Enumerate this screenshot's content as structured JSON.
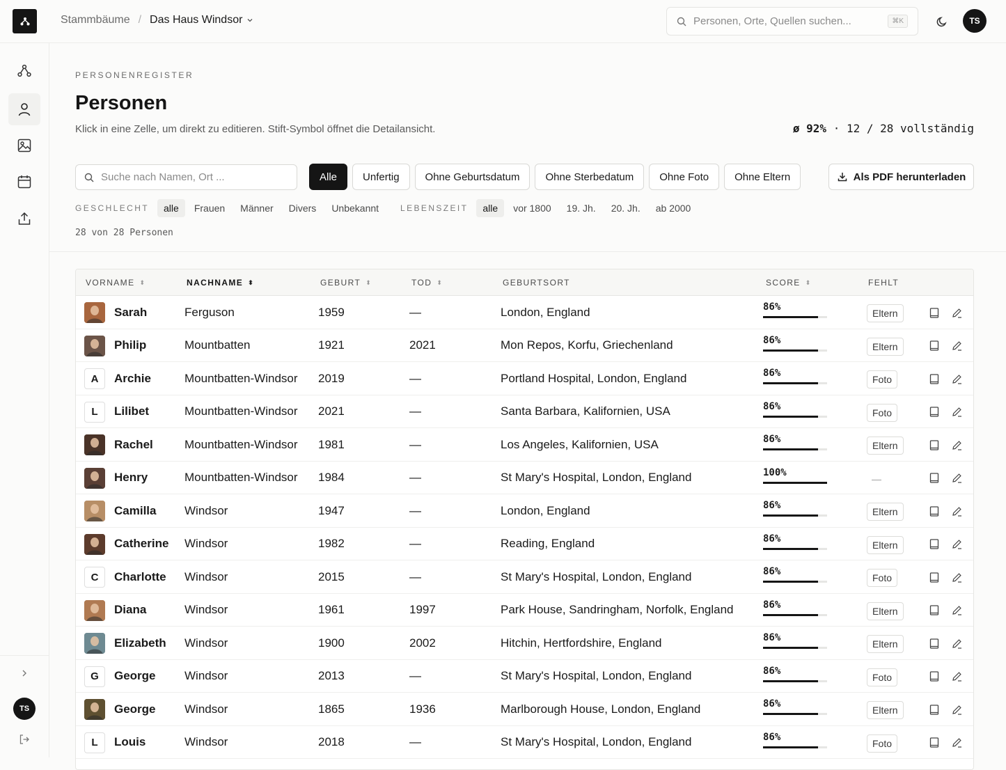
{
  "breadcrumb": {
    "root": "Stammbäume",
    "separator": "/",
    "current": "Das Haus Windsor"
  },
  "search": {
    "placeholder": "Personen, Orte, Quellen suchen...",
    "shortcut": "⌘K"
  },
  "user": {
    "initials": "TS"
  },
  "page": {
    "eyebrow": "PERSONENREGISTER",
    "title": "Personen",
    "subtitle": "Klick in eine Zelle, um direkt zu editieren. Stift-Symbol öffnet die Detailansicht.",
    "completeness_avg": "ø 92%",
    "completeness_rest": "· 12 / 28 vollständig"
  },
  "filter": {
    "placeholder": "Suche nach Namen, Ort ...",
    "chips": [
      "Alle",
      "Unfertig",
      "Ohne Geburtsdatum",
      "Ohne Sterbedatum",
      "Ohne Foto",
      "Ohne Eltern"
    ],
    "active_chip": "Alle",
    "pdf_label": "Als PDF herunterladen",
    "gender_label": "GESCHLECHT",
    "gender_options": [
      "alle",
      "Frauen",
      "Männer",
      "Divers",
      "Unbekannt"
    ],
    "lifetime_label": "LEBENSZEIT",
    "lifetime_options": [
      "alle",
      "vor 1800",
      "19. Jh.",
      "20. Jh.",
      "ab 2000"
    ],
    "count": "28 von 28 Personen"
  },
  "table": {
    "headers": [
      "VORNAME",
      "NACHNAME",
      "GEBURT",
      "TOD",
      "GEBURTSORT",
      "SCORE",
      "FEHLT"
    ],
    "rows": [
      {
        "first": "Sarah",
        "last": "Ferguson",
        "birth": "1959",
        "death": "—",
        "place": "London, England",
        "score": "86%",
        "score_value": 0.86,
        "missing": "Eltern",
        "photo": "#a8663e",
        "initial": ""
      },
      {
        "first": "Philip",
        "last": "Mountbatten",
        "birth": "1921",
        "death": "2021",
        "place": "Mon Repos, Korfu, Griechenland",
        "score": "86%",
        "score_value": 0.86,
        "missing": "Eltern",
        "photo": "#6b5448",
        "initial": ""
      },
      {
        "first": "Archie",
        "last": "Mountbatten-Windsor",
        "birth": "2019",
        "death": "—",
        "place": "Portland Hospital, London, England",
        "score": "86%",
        "score_value": 0.86,
        "missing": "Foto",
        "photo": "",
        "initial": "A"
      },
      {
        "first": "Lilibet",
        "last": "Mountbatten-Windsor",
        "birth": "2021",
        "death": "—",
        "place": "Santa Barbara, Kalifornien, USA",
        "score": "86%",
        "score_value": 0.86,
        "missing": "Foto",
        "photo": "",
        "initial": "L"
      },
      {
        "first": "Rachel",
        "last": "Mountbatten-Windsor",
        "birth": "1981",
        "death": "—",
        "place": "Los Angeles, Kalifornien, USA",
        "score": "86%",
        "score_value": 0.86,
        "missing": "Eltern",
        "photo": "#4a3328",
        "initial": ""
      },
      {
        "first": "Henry",
        "last": "Mountbatten-Windsor",
        "birth": "1984",
        "death": "—",
        "place": "St Mary's Hospital, London, England",
        "score": "100%",
        "score_value": 1.0,
        "missing": "—",
        "photo": "#5a3f35",
        "initial": ""
      },
      {
        "first": "Camilla",
        "last": "Windsor",
        "birth": "1947",
        "death": "—",
        "place": "London, England",
        "score": "86%",
        "score_value": 0.86,
        "missing": "Eltern",
        "photo": "#b78e66",
        "initial": ""
      },
      {
        "first": "Catherine",
        "last": "Windsor",
        "birth": "1982",
        "death": "—",
        "place": "Reading, England",
        "score": "86%",
        "score_value": 0.86,
        "missing": "Eltern",
        "photo": "#5c3b2c",
        "initial": ""
      },
      {
        "first": "Charlotte",
        "last": "Windsor",
        "birth": "2015",
        "death": "—",
        "place": "St Mary's Hospital, London, England",
        "score": "86%",
        "score_value": 0.86,
        "missing": "Foto",
        "photo": "",
        "initial": "C"
      },
      {
        "first": "Diana",
        "last": "Windsor",
        "birth": "1961",
        "death": "1997",
        "place": "Park House, Sandringham, Norfolk, England",
        "score": "86%",
        "score_value": 0.86,
        "missing": "Eltern",
        "photo": "#b07a52",
        "initial": ""
      },
      {
        "first": "Elizabeth",
        "last": "Windsor",
        "birth": "1900",
        "death": "2002",
        "place": "Hitchin, Hertfordshire, England",
        "score": "86%",
        "score_value": 0.86,
        "missing": "Eltern",
        "photo": "#6e8a92",
        "initial": ""
      },
      {
        "first": "George",
        "last": "Windsor",
        "birth": "2013",
        "death": "—",
        "place": "St Mary's Hospital, London, England",
        "score": "86%",
        "score_value": 0.86,
        "missing": "Foto",
        "photo": "",
        "initial": "G"
      },
      {
        "first": "George",
        "last": "Windsor",
        "birth": "1865",
        "death": "1936",
        "place": "Marlborough House, London, England",
        "score": "86%",
        "score_value": 0.86,
        "missing": "Eltern",
        "photo": "#5e5031",
        "initial": ""
      },
      {
        "first": "Louis",
        "last": "Windsor",
        "birth": "2018",
        "death": "—",
        "place": "St Mary's Hospital, London, England",
        "score": "86%",
        "score_value": 0.86,
        "missing": "Foto",
        "photo": "",
        "initial": "L"
      }
    ]
  },
  "icons": {
    "logo": "tree-icon",
    "search": "search-icon",
    "theme": "moon-icon",
    "sidebar": [
      "tree-icon",
      "person-icon",
      "image-icon",
      "calendar-icon",
      "upload-icon"
    ],
    "row_actions": [
      "book-icon",
      "pencil-icon"
    ],
    "expand": "chevron-right-icon",
    "logout": "logout-icon"
  }
}
